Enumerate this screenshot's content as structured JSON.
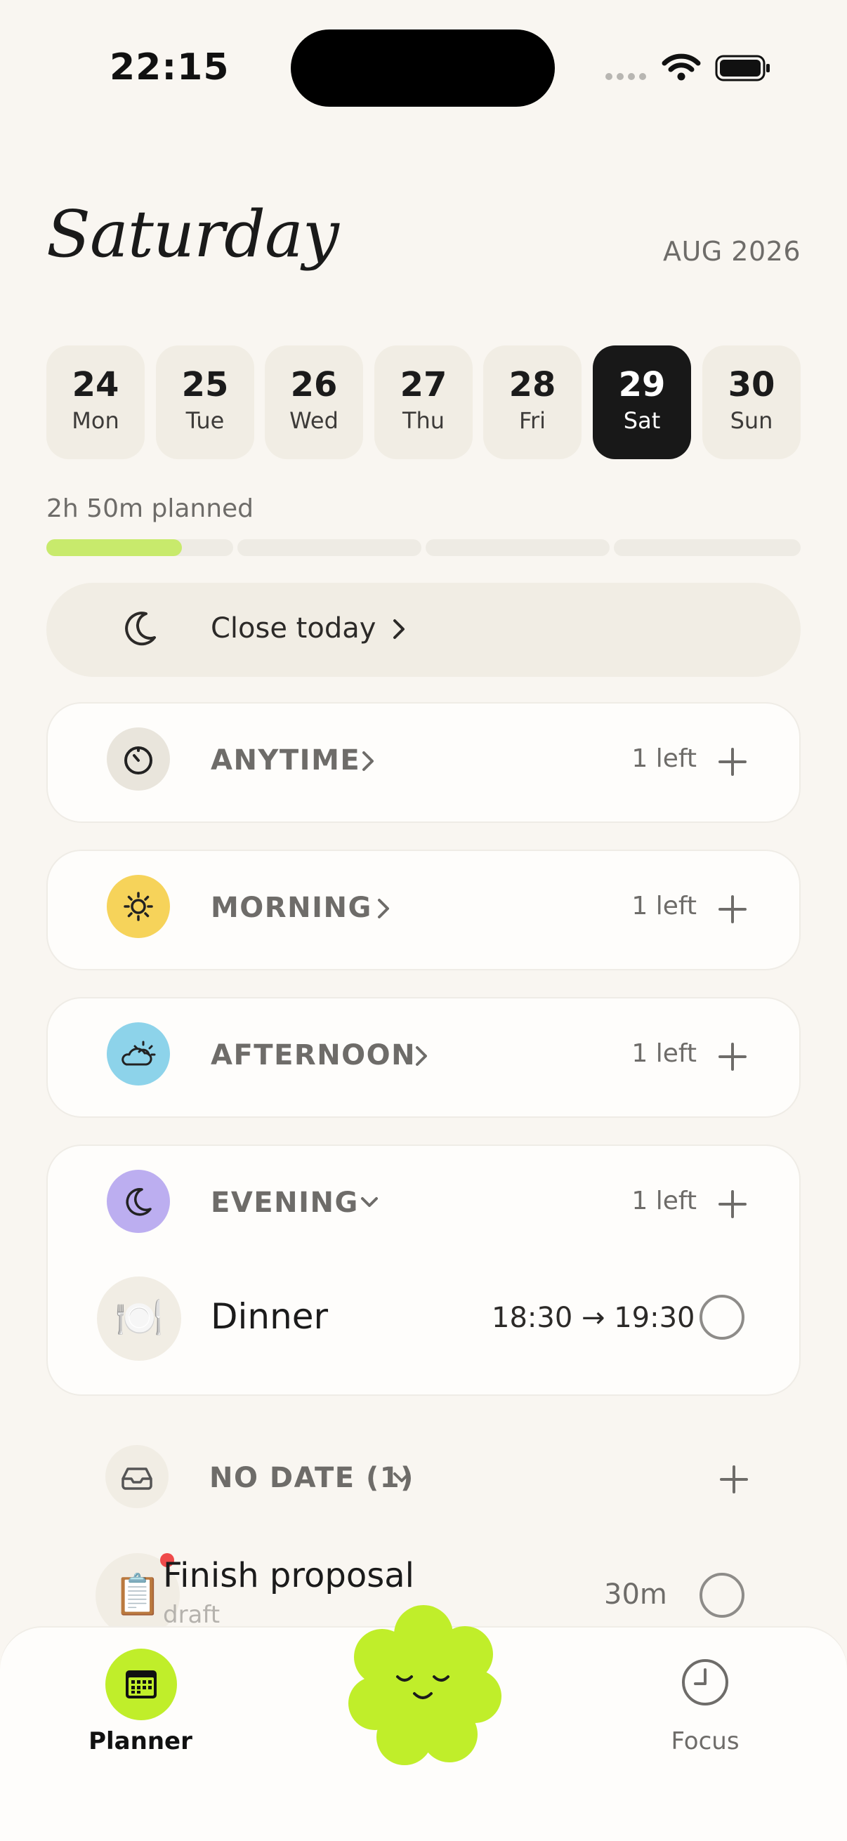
{
  "status": {
    "time": "22:15"
  },
  "header": {
    "day_title": "Saturday",
    "month": "AUG 2026"
  },
  "week": [
    {
      "num": "24",
      "dow": "Mon",
      "active": false
    },
    {
      "num": "25",
      "dow": "Tue",
      "active": false
    },
    {
      "num": "26",
      "dow": "Wed",
      "active": false
    },
    {
      "num": "27",
      "dow": "Thu",
      "active": false
    },
    {
      "num": "28",
      "dow": "Fri",
      "active": false
    },
    {
      "num": "29",
      "dow": "Sat",
      "active": true
    },
    {
      "num": "30",
      "dow": "Sun",
      "active": false
    }
  ],
  "planned": {
    "label": "2h 50m planned",
    "progress_fraction": 0.18
  },
  "close_today": {
    "label": "Close today"
  },
  "sections": {
    "anytime": {
      "label": "ANYTIME",
      "left": "1 left",
      "icon": "timer-icon",
      "color": "#e9e5dc"
    },
    "morning": {
      "label": "MORNING",
      "left": "1 left",
      "icon": "sun-icon",
      "color": "#f6d35a"
    },
    "afternoon": {
      "label": "AFTERNOON",
      "left": "1 left",
      "icon": "partly-cloudy-icon",
      "color": "#8dd3ea"
    },
    "evening": {
      "label": "EVENING",
      "left": "1 left",
      "icon": "moon-icon",
      "color": "#bcaef0",
      "tasks": [
        {
          "emoji": "🍽️",
          "title": "Dinner",
          "time": "18:30 → 19:30"
        }
      ]
    },
    "no_date": {
      "label": "NO DATE (1)",
      "icon": "inbox-icon",
      "color": "#f1ede4",
      "tasks": [
        {
          "emoji": "📋",
          "title": "Finish proposal",
          "subtitle": "draft",
          "duration": "30m"
        }
      ]
    }
  },
  "tabbar": {
    "planner_label": "Planner",
    "focus_label": "Focus"
  },
  "colors": {
    "accent": "#c0ee2a",
    "progress": "#c8ea6c",
    "background": "#f9f6f1"
  }
}
